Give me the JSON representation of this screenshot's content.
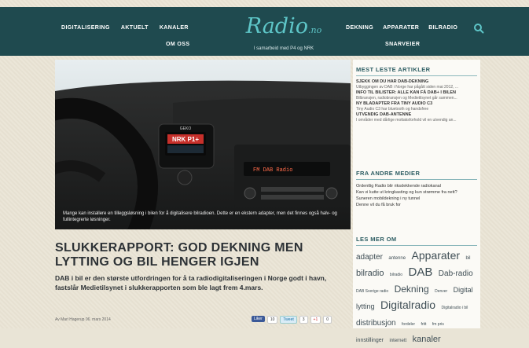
{
  "header": {
    "nav_left": [
      "DIGITALISERING",
      "AKTUELT",
      "KANALER"
    ],
    "nav_left_row2": "OM OSS",
    "logo_main": "Radio",
    "logo_suffix": ".no",
    "logo_tagline": "I samarbeid med P4 og NRK",
    "nav_right": [
      "DEKNING",
      "APPARATER",
      "BILRADIO"
    ],
    "nav_right_row2": "SNARVEIER",
    "search_icon": "search-icon",
    "bg_color": "#1f4a4f",
    "accent_color": "#5ec6c8"
  },
  "hero": {
    "radio_display": "NRK P1+",
    "radio_display_sub": "FM DAB Radio",
    "radio_brand": "GEKO",
    "caption": "Mange kan installere en tilleggsløsning i bilen for å digitalisere bilradioen. Dette er en ekstern adapter, men det finnes også halv- og fullintegrerte løsninger."
  },
  "article": {
    "title": "SLUKKERAPPORT: GOD DEKNING MEN LYTTING OG BIL HENGER IGJEN",
    "lead": "DAB i bil er den største utfordringen for å ta radiodigitaliseringen i Norge godt i havn, fastslår Medietilsynet i slukkerapporten som ble lagt frem 4.mars.",
    "byline": "Av Mari Hagerup    06. mars 2014",
    "share": {
      "fb": "Liker",
      "fb_count": "10",
      "tw": "Tweet",
      "tw_count": "3",
      "gp": "+1",
      "gp_count": "0"
    }
  },
  "sidebar": {
    "most_read_heading": "MEST LESTE ARTIKLER",
    "most_read": [
      {
        "title": "SJEKK OM DU HAR DAB-DEKNING",
        "summary": "Utbyggingen av DAB i Norge har pågått siden mai 2012, ..."
      },
      {
        "title": "INFO TIL BILISTER: ALLE KAN FÅ DAB+ I BILEN",
        "summary": "Bilbransjen, radiobransjen og Medietilsynet går sammen..."
      },
      {
        "title": "NY BLADAPTER FRA TINY AUDIO C3",
        "summary": "Tiny Audio C3 har bluetooth og handsfree"
      },
      {
        "title": "UTVENDIG DAB-ANTENNE",
        "summary": "I områder med dårlige mottaksforhold vil en utvendig an..."
      }
    ],
    "other_media_heading": "FRA ANDRE MEDIER",
    "other_media": [
      "Ordentlig Radio blir riksdekkende radiokanal",
      "Kan vi kutte ut kringkasting og kun strømme fra nett?",
      "Suneren mobildekning i ny tunnel",
      "Denne vil du få bruk for"
    ],
    "read_more_heading": "LES MER OM",
    "tags": [
      {
        "text": "adapter",
        "size": 10
      },
      {
        "text": "antenne",
        "size": 6
      },
      {
        "text": "Apparater",
        "size": 14
      },
      {
        "text": "bil",
        "size": 6
      },
      {
        "text": "bilradio",
        "size": 11
      },
      {
        "text": "bilradio",
        "size": 5
      },
      {
        "text": "DAB",
        "size": 15
      },
      {
        "text": "Dab-radio",
        "size": 10
      },
      {
        "text": "DAB Sverige radio",
        "size": 5
      },
      {
        "text": "Dekning",
        "size": 12
      },
      {
        "text": "Denver",
        "size": 5
      },
      {
        "text": "Digital lytting",
        "size": 9
      },
      {
        "text": "Digitalradio",
        "size": 14
      },
      {
        "text": "Digitalradio i bil",
        "size": 5
      },
      {
        "text": "distribusjon",
        "size": 10
      },
      {
        "text": "fordeler",
        "size": 5
      },
      {
        "text": "fritt",
        "size": 5
      },
      {
        "text": "fm pris",
        "size": 5
      },
      {
        "text": "innstillinger",
        "size": 7
      },
      {
        "text": "internett",
        "size": 6
      },
      {
        "text": "kanaler",
        "size": 11
      }
    ]
  }
}
